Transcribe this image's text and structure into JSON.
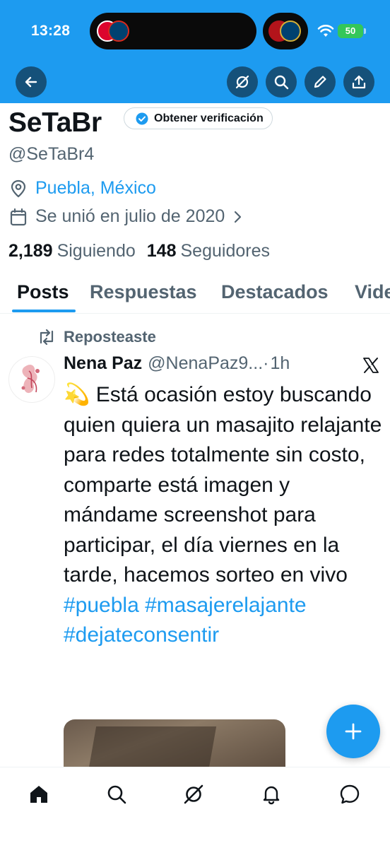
{
  "status_bar": {
    "time": "13:28",
    "battery": "50"
  },
  "profile": {
    "name": "SeTaBr",
    "verify_label": "Obtener verificación",
    "handle": "@SeTaBr4",
    "location": "Puebla, México",
    "joined": "Se unió en julio de 2020",
    "following_count": "2,189",
    "following_label": "Siguiendo",
    "followers_count": "148",
    "followers_label": "Seguidores"
  },
  "tabs": [
    {
      "label": "Posts"
    },
    {
      "label": "Respuestas"
    },
    {
      "label": "Destacados"
    },
    {
      "label": "Vide"
    }
  ],
  "post": {
    "repost_label": "Reposteaste",
    "author": "Nena Paz",
    "handle": "@NenaPaz9...",
    "separator": "·",
    "time": "1h",
    "emoji": "💫",
    "text": "Está ocasión estoy buscando quien quiera un masajito relajante para redes totalmente sin costo, comparte está imagen y mándame screenshot para participar, el día viernes en la tarde, hacemos sorteo en vivo",
    "hashtags": [
      "#puebla",
      "#masajerelajante",
      "#dejateconsentir"
    ]
  },
  "colors": {
    "accent": "#1d9bf0",
    "text_primary": "#0f1419",
    "text_secondary": "#536471"
  },
  "icons": {
    "back": "arrow-left-icon",
    "grok": "slash-circle-icon",
    "search": "search-icon",
    "edit": "pencil-icon",
    "share": "share-icon",
    "location": "location-pin-icon",
    "calendar": "calendar-icon",
    "repost": "repost-icon",
    "x_logo": "x-logo-icon",
    "fab": "plus-icon",
    "nav": [
      "home-icon",
      "search-icon",
      "grok-icon",
      "bell-icon",
      "message-icon"
    ]
  }
}
